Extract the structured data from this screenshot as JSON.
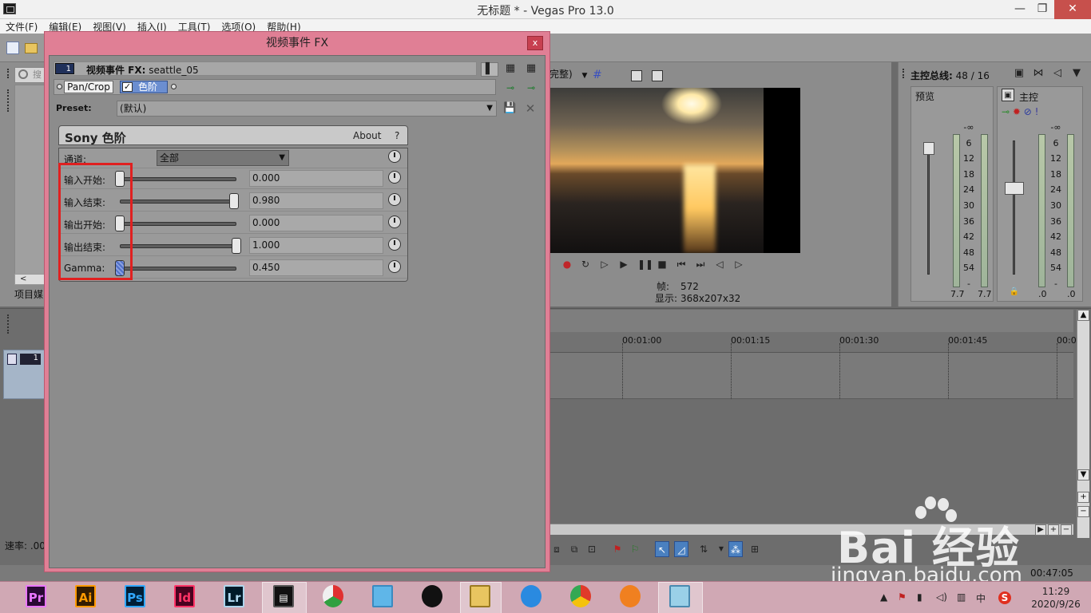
{
  "window": {
    "title": "无标题 * - Vegas Pro 13.0",
    "minimize": "—",
    "restore": "❐",
    "close": "✕"
  },
  "menu": [
    "文件(F)",
    "编辑(E)",
    "视图(V)",
    "插入(I)",
    "工具(T)",
    "选项(O)",
    "帮助(H)"
  ],
  "left_panel": {
    "search_placeholder": "搜",
    "scroll_left": "<",
    "tab_label": "项目媒"
  },
  "fx_dialog": {
    "title": "视频事件 FX",
    "close": "x",
    "header": {
      "track_number": "1",
      "title_bold": "视频事件 FX:",
      "event_name": "seattle_05"
    },
    "chain": {
      "pan_crop": "Pan/Crop",
      "levels": "色阶",
      "check": "✓"
    },
    "preset": {
      "label": "Preset:",
      "value": "(默认)",
      "arrow": "▼"
    },
    "plugin": {
      "name": "Sony 色阶",
      "about": "About",
      "help": "?"
    },
    "channel": {
      "label": "通道:",
      "value": "全部",
      "arrow": "▼"
    },
    "params": [
      {
        "label": "输入开始:",
        "value": "0.000",
        "level": 0.0
      },
      {
        "label": "输入结束:",
        "value": "0.980",
        "level": 0.98
      },
      {
        "label": "输出开始:",
        "value": "0.000",
        "level": 0.0
      },
      {
        "label": "输出结束:",
        "value": "1.000",
        "level": 1.0
      },
      {
        "label": "Gamma:",
        "value": "0.450",
        "level": 0.0
      }
    ]
  },
  "preview": {
    "quality_label": "完整)",
    "quality_arrow": "▼",
    "frame_label": "帧:",
    "frame_value": "572",
    "display_label": "显示:",
    "display_value": "368x207x32"
  },
  "transport": [
    "●",
    "↻",
    "▷",
    "▶",
    "❚❚",
    "■",
    "⏮",
    "⏭",
    "◁",
    "▷"
  ],
  "master_bus": {
    "title": "主控总线:",
    "count": "48 / 16",
    "preview_label": "预览",
    "master_label": "主控",
    "scale": [
      "-∞",
      "6",
      "12",
      "18",
      "24",
      "30",
      "36",
      "42",
      "48",
      "54",
      "-"
    ],
    "preview_values": [
      "7.7",
      "7.7"
    ],
    "master_values": [
      ".0",
      ".0"
    ]
  },
  "timeline": {
    "track_number": "1",
    "ruler": [
      "00:01:00",
      "00:01:15",
      "00:01:30",
      "00:01:45",
      "00:0"
    ],
    "rate_label": "速率: .00",
    "status_time": "00:47:05"
  },
  "watermark": {
    "logo": "Bai  经验",
    "url": "jingyan.baidu.com"
  },
  "taskbar": {
    "apps": [
      {
        "label": "Pr",
        "color": "#ea77ff",
        "bg": "#2a0a34"
      },
      {
        "label": "Ai",
        "color": "#ff9a00",
        "bg": "#331c00"
      },
      {
        "label": "Ps",
        "color": "#31a8ff",
        "bg": "#001e36"
      },
      {
        "label": "Id",
        "color": "#ff3366",
        "bg": "#49021f"
      },
      {
        "label": "Lr",
        "color": "#add5ec",
        "bg": "#001a29"
      }
    ],
    "clock_time": "11:29",
    "clock_date": "2020/9/26",
    "tray_lang": "中",
    "tray_ime": "S"
  }
}
